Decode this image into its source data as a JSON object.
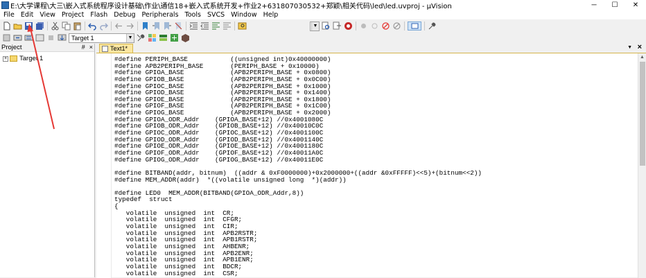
{
  "window": {
    "title": "E:\\大学课程\\大三\\嵌入式系统程序设计基础\\作业\\通信18+嵌入式系统开发+作业2+631807030532+郑颖\\相关代码\\led\\led.uvproj - µVision",
    "controls": [
      "─",
      "☐",
      "✕"
    ]
  },
  "menu": [
    {
      "label": "File"
    },
    {
      "label": "Edit"
    },
    {
      "label": "View"
    },
    {
      "label": "Project"
    },
    {
      "label": "Flash"
    },
    {
      "label": "Debug"
    },
    {
      "label": "Peripherals"
    },
    {
      "label": "Tools"
    },
    {
      "label": "SVCS"
    },
    {
      "label": "Window"
    },
    {
      "label": "Help"
    }
  ],
  "toolbar2": {
    "target_select": "Target 1"
  },
  "project_panel": {
    "header": "Project",
    "header_icons": [
      "#",
      "×"
    ],
    "tree": [
      {
        "expander": "+",
        "label": "Target 1"
      }
    ]
  },
  "editor": {
    "tab_label": "Text1*",
    "pin": "▼",
    "close": "×",
    "lines": [
      "#define PERIPH_BASE           ((unsigned int)0x40000000)",
      "#define APB2PERIPH_BASE       (PERIPH_BASE + 0x10000)",
      "#define GPIOA_BASE            (APB2PERIPH_BASE + 0x0800)",
      "#define GPIOB_BASE            (APB2PERIPH_BASE + 0x0C00)",
      "#define GPIOC_BASE            (APB2PERIPH_BASE + 0x1000)",
      "#define GPIOD_BASE            (APB2PERIPH_BASE + 0x1400)",
      "#define GPIOE_BASE            (APB2PERIPH_BASE + 0x1800)",
      "#define GPIOF_BASE            (APB2PERIPH_BASE + 0x1C00)",
      "#define GPIOG_BASE            (APB2PERIPH_BASE + 0x2000)",
      "#define GPIOA_ODR_Addr    (GPIOA_BASE+12) //0x4001080C",
      "#define GPIOB_ODR_Addr    (GPIOB_BASE+12) //0x40010C0C",
      "#define GPIOC_ODR_Addr    (GPIOC_BASE+12) //0x4001100C",
      "#define GPIOD_ODR_Addr    (GPIOD_BASE+12) //0x4001140C",
      "#define GPIOE_ODR_Addr    (GPIOE_BASE+12) //0x4001180C",
      "#define GPIOF_ODR_Addr    (GPIOF_BASE+12) //0x40011A0C",
      "#define GPIOG_ODR_Addr    (GPIOG_BASE+12) //0x40011E0C",
      "",
      "#define BITBAND(addr, bitnum)  ((addr & 0xF0000000)+0x2000000+((addr &0xFFFFF)<<5)+(bitnum<<2))",
      "#define MEM_ADDR(addr)  *((volatile unsigned long  *)(addr))",
      "",
      "#define LED0  MEM_ADDR(BITBAND(GPIOA_ODR_Addr,8))",
      "typedef  struct",
      "{",
      "   volatile  unsigned  int  CR;",
      "   volatile  unsigned  int  CFGR;",
      "   volatile  unsigned  int  CIR;",
      "   volatile  unsigned  int  APB2RSTR;",
      "   volatile  unsigned  int  APB1RSTR;",
      "   volatile  unsigned  int  AHBENR;",
      "   volatile  unsigned  int  APB2ENR;",
      "   volatile  unsigned  int  APB1ENR;",
      "   volatile  unsigned  int  BDCR;",
      "   volatile  unsigned  int  CSR;"
    ]
  },
  "colors": {
    "tab_bg": "#fbe7a1",
    "annotation_arrow": "#e53935"
  }
}
